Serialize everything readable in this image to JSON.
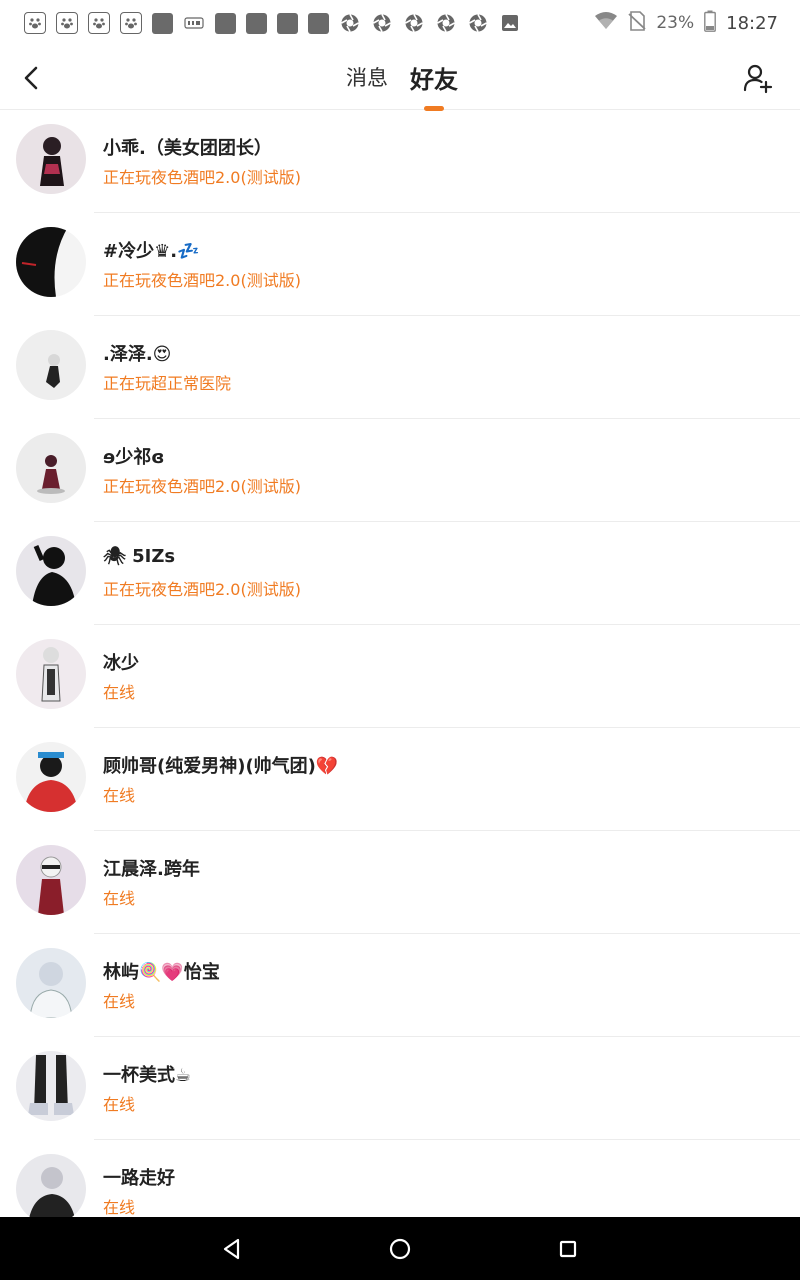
{
  "status_bar": {
    "battery_percent": "23%",
    "time": "18:27",
    "notification_icons": [
      "baidu-paw-icon",
      "baidu-paw-icon",
      "baidu-paw-icon",
      "baidu-paw-icon",
      "app-square-icon",
      "iqiyi-icon",
      "app-square-icon",
      "app-square-icon",
      "app-square-icon",
      "app-square-icon",
      "shutter-icon",
      "shutter-icon",
      "shutter-icon",
      "shutter-icon",
      "shutter-icon",
      "image-icon"
    ]
  },
  "header": {
    "tabs": [
      {
        "label": "消息",
        "active": false
      },
      {
        "label": "好友",
        "active": true
      }
    ],
    "accent_color": "#f07b22"
  },
  "friends": [
    {
      "name": "小乖.（美女团团长）",
      "status": "正在玩夜色酒吧2.0(测试版)",
      "avatar_bg": "#e9e2e6"
    },
    {
      "name": "#冷少♛.💤",
      "status": "正在玩夜色酒吧2.0(测试版)",
      "avatar_bg": "#1a1a1a"
    },
    {
      "name": ".泽泽.😍",
      "status": "正在玩超正常医院",
      "avatar_bg": "#eeeeee"
    },
    {
      "name": "ɘ少祁ɞ",
      "status": "正在玩夜色酒吧2.0(测试版)",
      "avatar_bg": "#ececec"
    },
    {
      "name": "🕷 5IZs",
      "status": "正在玩夜色酒吧2.0(测试版)",
      "avatar_bg": "#e7e5ea"
    },
    {
      "name": "冰少",
      "status": "在线",
      "avatar_bg": "#f0eaee"
    },
    {
      "name": "顾帅哥(纯爱男神)(帅气团)💔",
      "status": "在线",
      "avatar_bg": "#d63030"
    },
    {
      "name": "江晨泽.跨年",
      "status": "在线",
      "avatar_bg": "#e6dde8"
    },
    {
      "name": "林屿🍭💗怡宝",
      "status": "在线",
      "avatar_bg": "#e4e9ef"
    },
    {
      "name": "一杯美式☕",
      "status": "在线",
      "avatar_bg": "#ebebef"
    },
    {
      "name": "一路走好",
      "status": "在线",
      "avatar_bg": "#e8e8ec"
    }
  ]
}
